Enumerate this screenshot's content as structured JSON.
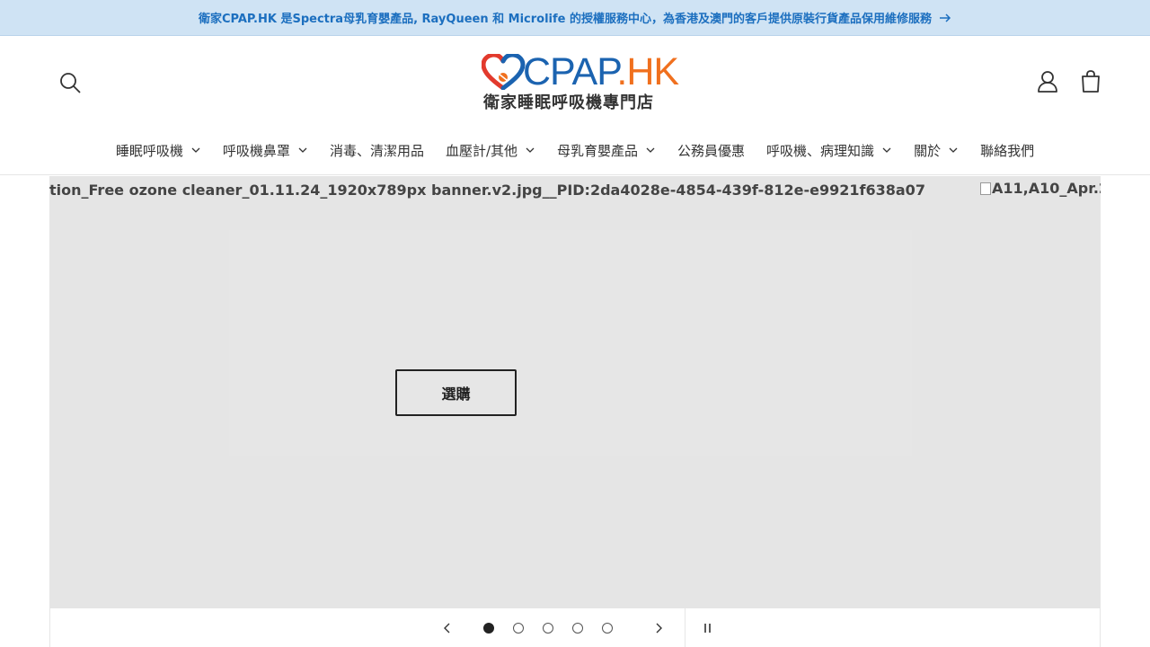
{
  "announcement": {
    "text": "衛家CPAP.HK 是Spectra母乳育嬰產品, RayQueen 和 Microlife 的授權服務中心，為香港及澳門的客戶提供原裝行貨產品保用維修服務",
    "arrow_icon": "arrow-right-icon"
  },
  "header": {
    "logo": {
      "brand_main": "CPAP",
      "brand_suffix": ".HK",
      "subtitle": "衛家睡眠呼吸機專門店",
      "colors": {
        "blue": "#1b63b0",
        "orange": "#f0701e",
        "red": "#e23a2d"
      }
    },
    "icons": {
      "search": "search-icon",
      "account": "account-icon",
      "cart": "cart-icon"
    }
  },
  "nav": {
    "items": [
      {
        "label": "睡眠呼吸機",
        "has_dropdown": true
      },
      {
        "label": "呼吸機鼻罩",
        "has_dropdown": true
      },
      {
        "label": "消毒、清潔用品",
        "has_dropdown": false
      },
      {
        "label": "血壓計/其他",
        "has_dropdown": true
      },
      {
        "label": "母乳育嬰產品",
        "has_dropdown": true
      },
      {
        "label": "公務員優惠",
        "has_dropdown": false
      },
      {
        "label": "呼吸機、病理知識",
        "has_dropdown": true
      },
      {
        "label": "關於",
        "has_dropdown": true
      },
      {
        "label": "聯絡我們",
        "has_dropdown": false
      }
    ]
  },
  "slideshow": {
    "current_alt": "tion_Free ozone cleaner_01.11.24_1920x789px banner.v2.jpg__PID:2da4028e-4854-439f-812e-e9921f638a07",
    "next_alt": "A11,A10_Apr.2",
    "button_label": "選購",
    "slide_count": 5,
    "active_index": 0,
    "icons": {
      "prev": "chevron-left-icon",
      "next": "chevron-right-icon",
      "pause": "pause-icon"
    }
  }
}
